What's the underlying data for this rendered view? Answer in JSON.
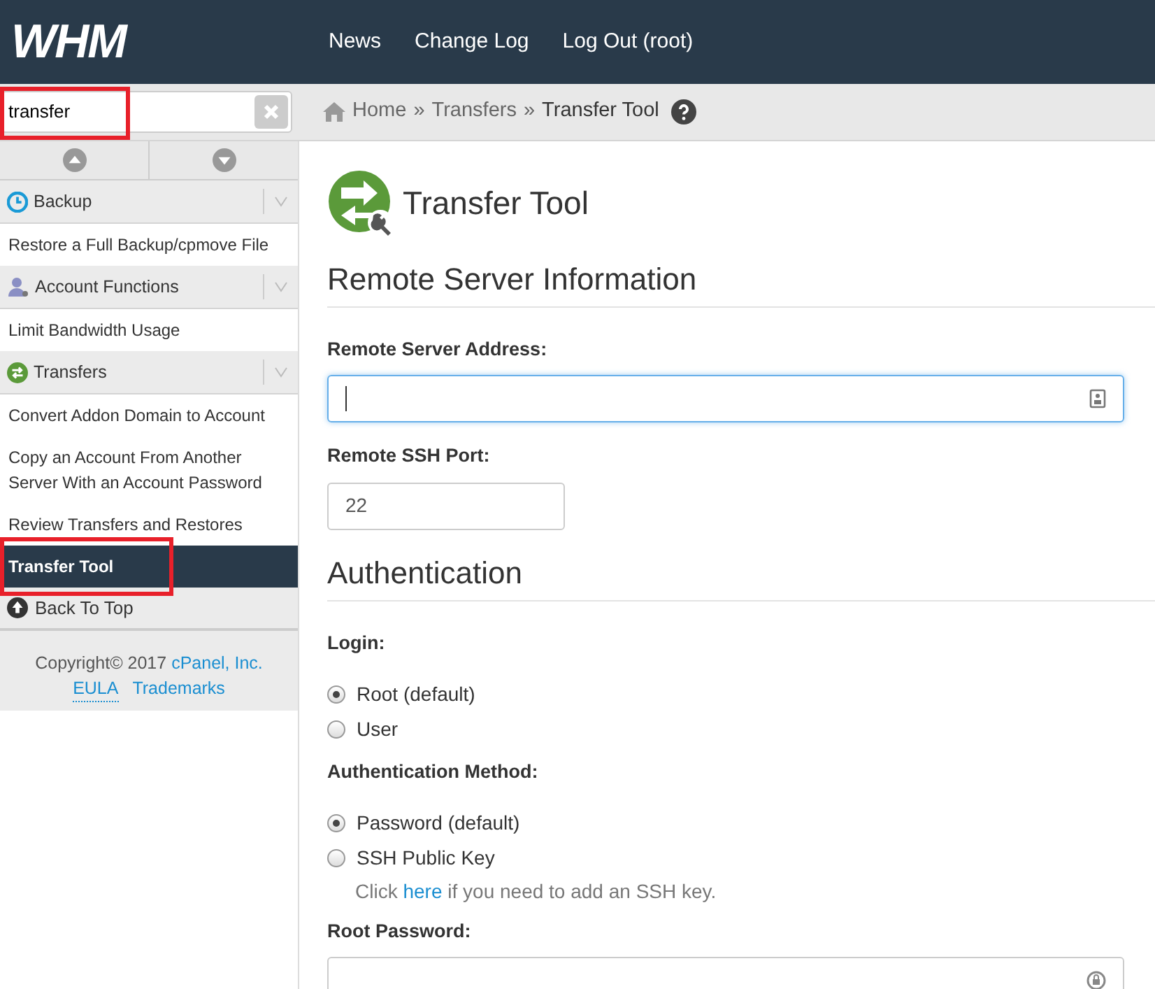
{
  "header": {
    "logo": "WHM",
    "nav": [
      "News",
      "Change Log",
      "Log Out (root)"
    ]
  },
  "search": {
    "value": "transfer",
    "highlighted": true
  },
  "breadcrumb": {
    "items": [
      "Home",
      "Transfers",
      "Transfer Tool"
    ],
    "separator": "»"
  },
  "sidebar": {
    "groups": [
      {
        "title": "Backup",
        "items": [
          {
            "label": "Restore a Full Backup/cpmove File",
            "selected": false,
            "highlighted": false
          }
        ]
      },
      {
        "title": "Account Functions",
        "items": [
          {
            "label": "Limit Bandwidth Usage",
            "selected": false,
            "highlighted": false
          }
        ]
      },
      {
        "title": "Transfers",
        "items": [
          {
            "label": "Convert Addon Domain to Account",
            "selected": false,
            "highlighted": false
          },
          {
            "label": "Copy an Account From Another Server With an Account Password",
            "selected": false,
            "highlighted": false
          },
          {
            "label": "Review Transfers and Restores",
            "selected": false,
            "highlighted": false
          },
          {
            "label": "Transfer Tool",
            "selected": true,
            "highlighted": true
          }
        ]
      }
    ],
    "back_to_top": "Back To Top",
    "copyright": "Copyright© 2017",
    "company": "cPanel, Inc.",
    "links": [
      "EULA",
      "Trademarks"
    ]
  },
  "page": {
    "title": "Transfer Tool",
    "sections": [
      {
        "heading": "Remote Server Information",
        "fields": [
          {
            "kind": "address",
            "label": "Remote Server Address:",
            "focused": true
          },
          {
            "kind": "port",
            "label": "Remote SSH Port:",
            "value": "22",
            "focused": false
          }
        ]
      },
      {
        "heading": "Authentication",
        "fields": [
          {
            "kind": "radios",
            "label": "Login:",
            "options": [
              {
                "label": "Root (default)",
                "selected": true
              },
              {
                "label": "User",
                "selected": false
              }
            ]
          },
          {
            "kind": "radios",
            "label": "Authentication Method:",
            "options": [
              {
                "label": "Password (default)",
                "selected": true
              },
              {
                "label": "SSH Public Key",
                "selected": false
              }
            ],
            "hint": {
              "before": "Click ",
              "link": "here",
              "after": " if you need to add an SSH key."
            }
          },
          {
            "kind": "password",
            "label": "Root Password:",
            "focused": false
          }
        ]
      }
    ]
  }
}
